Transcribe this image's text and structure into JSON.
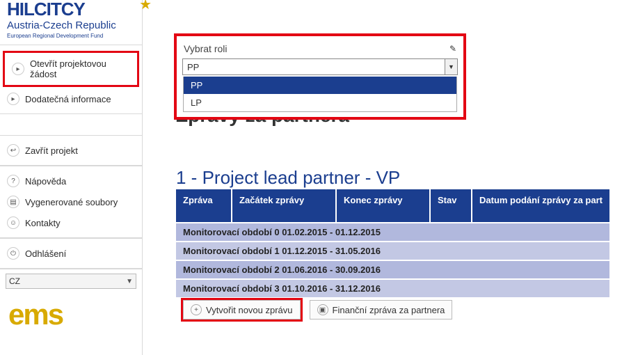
{
  "logo": {
    "line1": "HILCITCY",
    "line2": "Austria-Czech Republic",
    "line3": "European Regional Development Fund"
  },
  "sidebar": {
    "open_app": "Otevřít projektovou žádost",
    "additional_info": "Dodatečná informace",
    "close_project": "Zavřít projekt",
    "help": "Nápověda",
    "generated_files": "Vygenerované soubory",
    "contacts": "Kontakty",
    "logout": "Odhlášení",
    "lang": "CZ",
    "ems": "ems"
  },
  "role": {
    "label": "Vybrat roli",
    "value": "PP",
    "options": [
      "PP",
      "LP"
    ]
  },
  "hidden_title": "Zprávy za partnera",
  "section_title": "1 - Project lead partner - VP",
  "table": {
    "headers": {
      "zprava": "Zpráva",
      "zacatek": "Začátek zprávy",
      "konec": "Konec zprávy",
      "stav": "Stav",
      "datum": "Datum podání zprávy za part"
    },
    "rows": [
      "Monitorovací období 0 01.02.2015 - 01.12.2015",
      "Monitorovací období 1 01.12.2015 - 31.05.2016",
      "Monitorovací období 2 01.06.2016 - 30.09.2016",
      "Monitorovací období 3 01.10.2016 - 31.12.2016"
    ]
  },
  "actions": {
    "new_report": "Vytvořit novou zprávu",
    "fin_report": "Finanční zpráva za partnera"
  }
}
